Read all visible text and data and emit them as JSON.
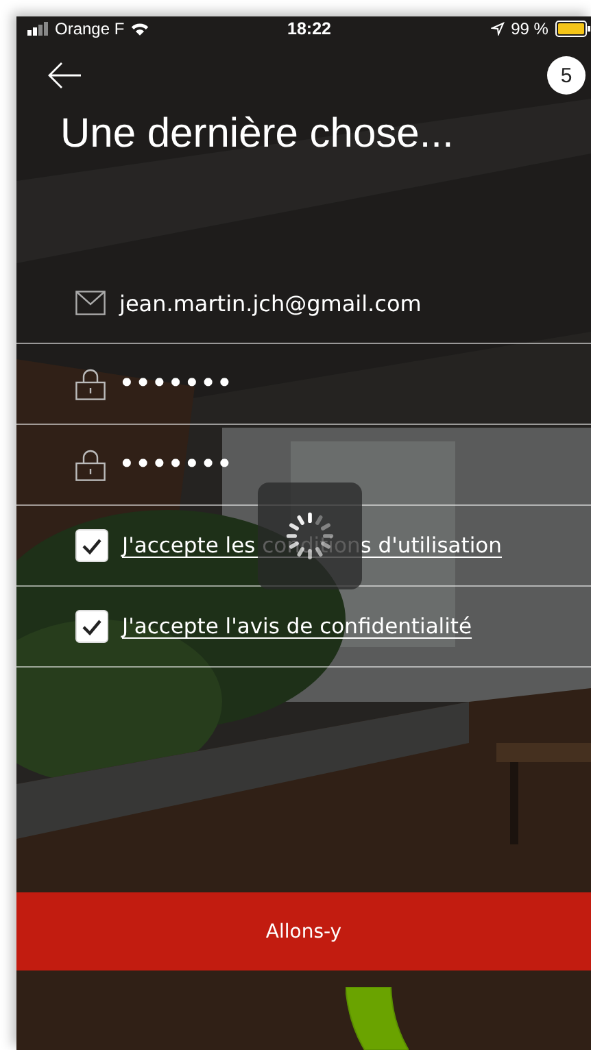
{
  "status_bar": {
    "carrier": "Orange F",
    "time": "18:22",
    "battery": "99 %"
  },
  "header": {
    "step": "5",
    "title": "Une dernière chose..."
  },
  "fields": [
    {
      "kind": "email",
      "value": "jean.martin.jch@gmail.com"
    },
    {
      "kind": "password",
      "value": "•••••••"
    },
    {
      "kind": "password",
      "value": "•••••••"
    }
  ],
  "agreements": [
    {
      "label": "J'accepte les conditions d'utilisation",
      "checked": true
    },
    {
      "label": "J'accepte l'avis de confidentialité",
      "checked": true
    }
  ],
  "loading": true,
  "submit": {
    "label": "Allons-y"
  }
}
